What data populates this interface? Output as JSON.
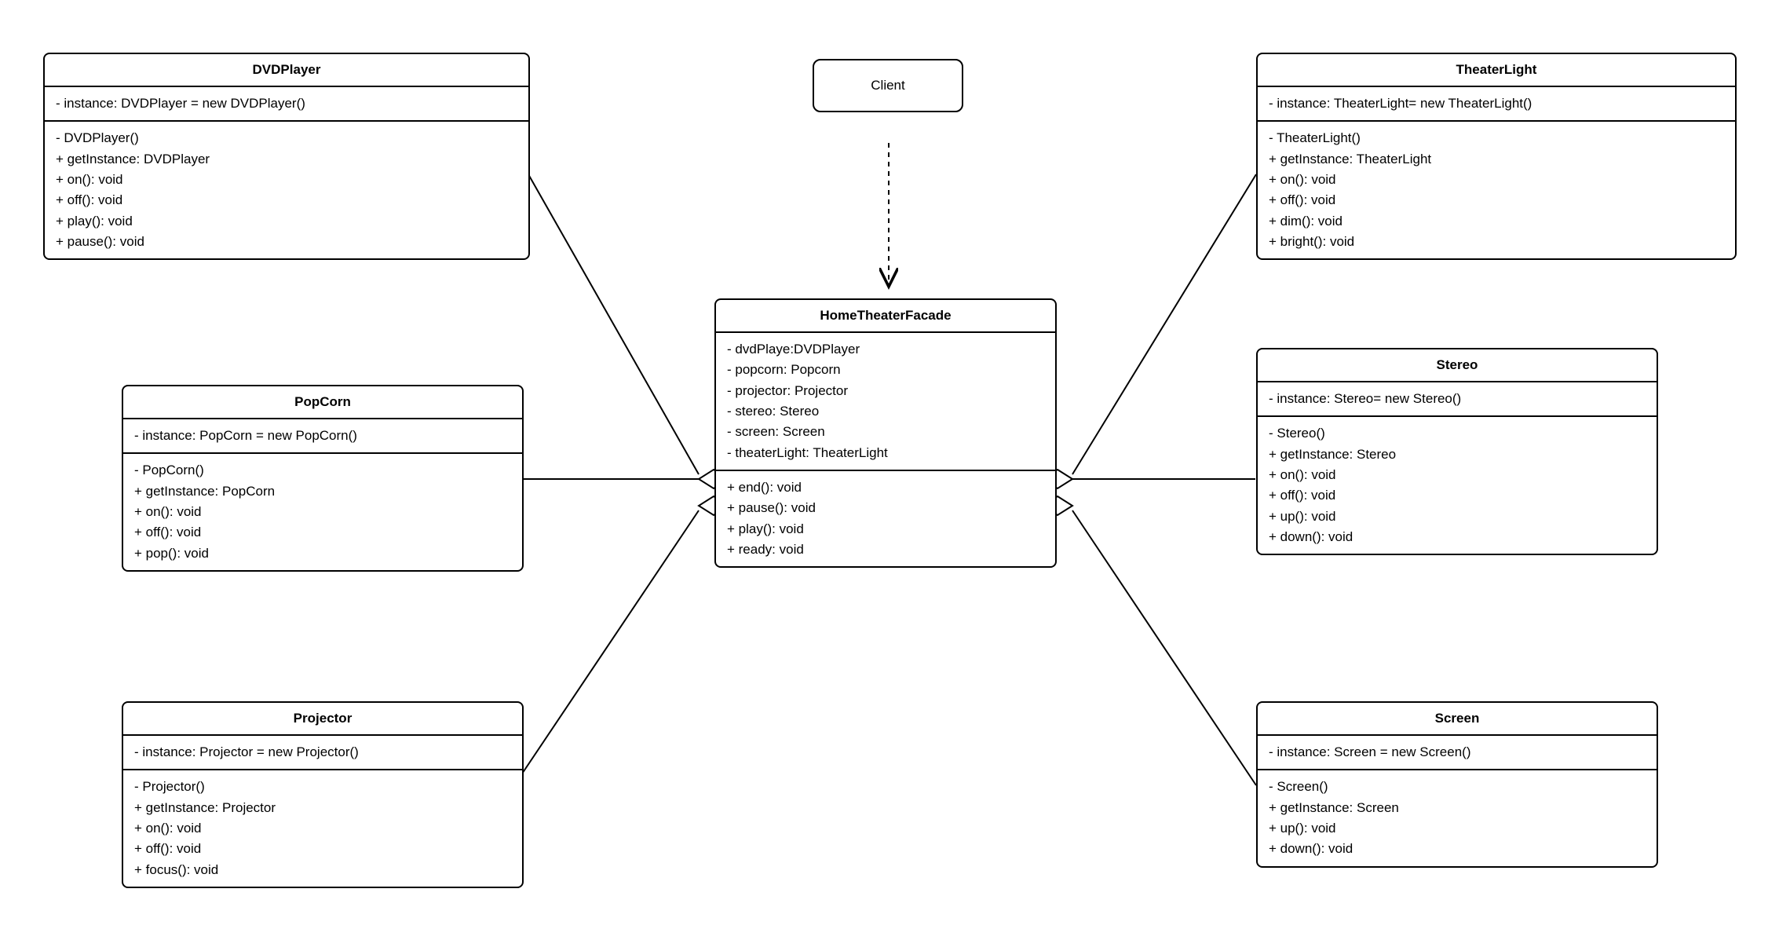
{
  "client": {
    "title": "Client"
  },
  "facade": {
    "title": "HomeTheaterFacade",
    "attrs": [
      "- dvdPlaye:DVDPlayer",
      "- popcorn: Popcorn",
      "- projector: Projector",
      "- stereo: Stereo",
      "- screen: Screen",
      "- theaterLight: TheaterLight"
    ],
    "methods": [
      "+ end(): void",
      "+ pause(): void",
      "+ play(): void",
      "+ ready: void"
    ]
  },
  "dvdplayer": {
    "title": "DVDPlayer",
    "attrs": [
      "- instance: DVDPlayer = new DVDPlayer()"
    ],
    "methods": [
      "-  DVDPlayer()",
      "+ getInstance: DVDPlayer",
      "+ on(): void",
      "+ off(): void",
      "+ play(): void",
      "+ pause(): void"
    ]
  },
  "popcorn": {
    "title": "PopCorn",
    "attrs": [
      "- instance: PopCorn = new PopCorn()"
    ],
    "methods": [
      "-  PopCorn()",
      "+ getInstance: PopCorn",
      "+ on(): void",
      "+ off(): void",
      "+ pop(): void"
    ]
  },
  "projector": {
    "title": "Projector",
    "attrs": [
      "- instance: Projector = new Projector()"
    ],
    "methods": [
      "-  Projector()",
      "+ getInstance: Projector",
      "+ on(): void",
      "+ off(): void",
      "+ focus(): void"
    ]
  },
  "theaterlight": {
    "title": "TheaterLight",
    "attrs": [
      "- instance: TheaterLight= new TheaterLight()"
    ],
    "methods": [
      "-  TheaterLight()",
      "+ getInstance: TheaterLight",
      "+ on(): void",
      "+ off(): void",
      "+ dim(): void",
      "+ bright(): void"
    ]
  },
  "stereo": {
    "title": "Stereo",
    "attrs": [
      "- instance: Stereo= new Stereo()"
    ],
    "methods": [
      "-  Stereo()",
      "+ getInstance: Stereo",
      "+ on(): void",
      "+ off(): void",
      "+ up(): void",
      "+ down(): void"
    ]
  },
  "screen": {
    "title": "Screen",
    "attrs": [
      "- instance: Screen = new Screen()"
    ],
    "methods": [
      "-  Screen()",
      "+ getInstance: Screen",
      "+ up(): void",
      "+ down(): void"
    ]
  }
}
